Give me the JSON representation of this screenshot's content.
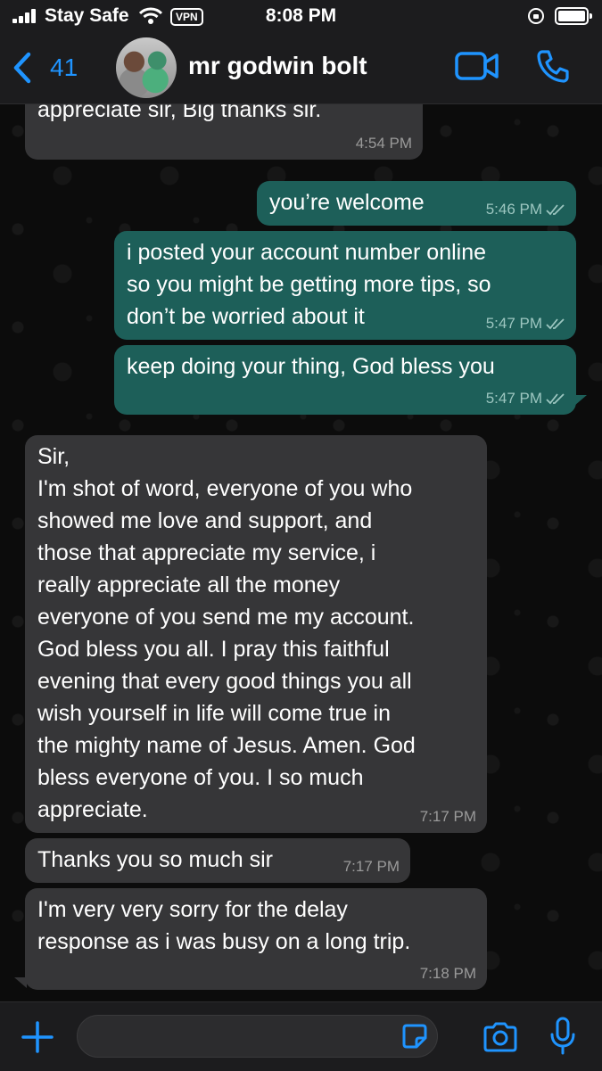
{
  "status_bar": {
    "carrier": "Stay Safe",
    "vpn": "VPN",
    "time": "8:08 PM"
  },
  "header": {
    "back_count": "41",
    "contact_name": "mr godwin bolt"
  },
  "colors": {
    "accent": "#1f94ff",
    "outgoing_bubble": "#1d5f59",
    "incoming_bubble": "#363638",
    "background": "#0c0c0c"
  },
  "messages": [
    {
      "direction": "incoming",
      "text": "appreciate sir, Big thanks sir.",
      "time": "4:54 PM"
    },
    {
      "direction": "outgoing",
      "text": "you’re welcome",
      "time": "5:46 PM",
      "status": "read"
    },
    {
      "direction": "outgoing",
      "text": "i posted your account number online\nso you might be getting more tips, so\ndon’t be worried about it",
      "time": "5:47 PM",
      "status": "read"
    },
    {
      "direction": "outgoing",
      "text": "keep doing your thing, God bless you",
      "time": "5:47 PM",
      "status": "read"
    },
    {
      "direction": "incoming",
      "text": "Sir,\nI'm shot of word, everyone of you who\nshowed me love and support, and\nthose that appreciate my service, i\nreally appreciate all the money\neveryone of you send me my account.\nGod bless you all. I pray this faithful\nevening that every good things you all\nwish yourself in life will come true in\nthe mighty name of Jesus. Amen. God\nbless everyone of you. I so much\nappreciate.",
      "time": "7:17 PM"
    },
    {
      "direction": "incoming",
      "text": "Thanks you so much sir",
      "time": "7:17 PM"
    },
    {
      "direction": "incoming",
      "text": "I'm very very sorry for the delay\nresponse as i was busy on a long trip.",
      "time": "7:18 PM"
    }
  ],
  "input": {
    "value": "",
    "placeholder": ""
  },
  "icons": {
    "back": "chevron-left-icon",
    "video": "video-camera-icon",
    "call": "phone-icon",
    "attach": "plus-icon",
    "sticker": "sticker-icon",
    "camera": "camera-icon",
    "mic": "microphone-icon"
  }
}
